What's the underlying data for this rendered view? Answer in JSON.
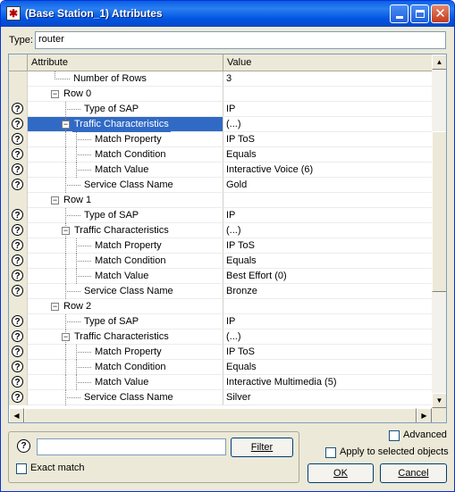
{
  "window": {
    "title": "(Base Station_1) Attributes",
    "app_icon": "app-star-icon",
    "controls": [
      "minimize-icon",
      "maximize-icon",
      "close-icon"
    ]
  },
  "type_row": {
    "label": "Type:",
    "value": "router"
  },
  "grid": {
    "columns": [
      "Attribute",
      "Value"
    ],
    "rows": [
      {
        "indent": 1,
        "label": "Number of Rows",
        "value": "3",
        "help": false,
        "node": "leaf"
      },
      {
        "indent": 1,
        "label": "Row 0",
        "value": "",
        "help": false,
        "node": "expanded"
      },
      {
        "indent": 2,
        "label": "Type of SAP",
        "value": "IP",
        "help": true,
        "node": "leaf"
      },
      {
        "indent": 2,
        "label": "Traffic Characteristics",
        "value": "(...)",
        "help": true,
        "node": "expanded",
        "selected": true
      },
      {
        "indent": 3,
        "label": "Match Property",
        "value": "IP ToS",
        "help": true,
        "node": "leaf"
      },
      {
        "indent": 3,
        "label": "Match Condition",
        "value": "Equals",
        "help": true,
        "node": "leaf"
      },
      {
        "indent": 3,
        "label": "Match Value",
        "value": "Interactive Voice (6)",
        "help": true,
        "node": "leaf"
      },
      {
        "indent": 2,
        "label": "Service Class Name",
        "value": "Gold",
        "help": true,
        "node": "leaf"
      },
      {
        "indent": 1,
        "label": "Row 1",
        "value": "",
        "help": false,
        "node": "expanded"
      },
      {
        "indent": 2,
        "label": "Type of SAP",
        "value": "IP",
        "help": true,
        "node": "leaf"
      },
      {
        "indent": 2,
        "label": "Traffic Characteristics",
        "value": "(...)",
        "help": true,
        "node": "expanded"
      },
      {
        "indent": 3,
        "label": "Match Property",
        "value": "IP ToS",
        "help": true,
        "node": "leaf"
      },
      {
        "indent": 3,
        "label": "Match Condition",
        "value": "Equals",
        "help": true,
        "node": "leaf"
      },
      {
        "indent": 3,
        "label": "Match Value",
        "value": "Best Effort (0)",
        "help": true,
        "node": "leaf"
      },
      {
        "indent": 2,
        "label": "Service Class Name",
        "value": "Bronze",
        "help": true,
        "node": "leaf"
      },
      {
        "indent": 1,
        "label": "Row 2",
        "value": "",
        "help": false,
        "node": "expanded"
      },
      {
        "indent": 2,
        "label": "Type of SAP",
        "value": "IP",
        "help": true,
        "node": "leaf"
      },
      {
        "indent": 2,
        "label": "Traffic Characteristics",
        "value": "(...)",
        "help": true,
        "node": "expanded"
      },
      {
        "indent": 3,
        "label": "Match Property",
        "value": "IP ToS",
        "help": true,
        "node": "leaf"
      },
      {
        "indent": 3,
        "label": "Match Condition",
        "value": "Equals",
        "help": true,
        "node": "leaf"
      },
      {
        "indent": 3,
        "label": "Match Value",
        "value": "Interactive Multimedia (5)",
        "help": true,
        "node": "leaf"
      },
      {
        "indent": 2,
        "label": "Service Class Name",
        "value": "Silver",
        "help": true,
        "node": "leaf"
      }
    ]
  },
  "filter": {
    "help_icon": "?",
    "placeholder": "",
    "button_label": "Filter",
    "exact_match_label": "Exact match"
  },
  "options": {
    "advanced_label": "Advanced",
    "apply_label": "Apply to selected objects"
  },
  "buttons": {
    "ok_label": "OK",
    "cancel_label": "Cancel"
  },
  "colors": {
    "titlebar": "#0054e3",
    "selection": "#316ac5",
    "dialog_bg": "#ece9d8"
  }
}
